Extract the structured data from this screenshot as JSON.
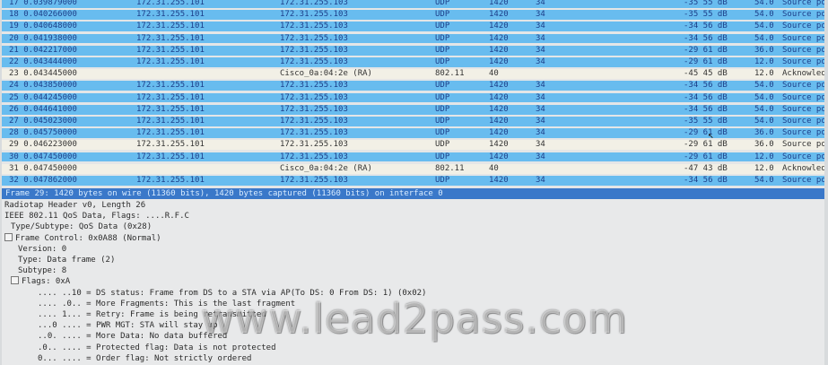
{
  "packets": [
    {
      "no_time": "17 0.039879000",
      "src": "172.31.255.101",
      "dst": "172.31.255.103",
      "proto": "UDP",
      "len": "1420",
      "info1": "34",
      "signal": "-35 55 dB",
      "rate": "54.0",
      "info": "Source port:"
    },
    {
      "no_time": "18 0.040266000",
      "src": "172.31.255.101",
      "dst": "172.31.255.103",
      "proto": "UDP",
      "len": "1420",
      "info1": "34",
      "signal": "-35 55 dB",
      "rate": "54.0",
      "info": "Source port:"
    },
    {
      "no_time": "19 0.040648000",
      "src": "172.31.255.101",
      "dst": "172.31.255.103",
      "proto": "UDP",
      "len": "1420",
      "info1": "34",
      "signal": "-34 56 dB",
      "rate": "54.0",
      "info": "Source port:"
    },
    {
      "no_time": "20 0.041938000",
      "src": "172.31.255.101",
      "dst": "172.31.255.103",
      "proto": "UDP",
      "len": "1420",
      "info1": "34",
      "signal": "-34 56 dB",
      "rate": "54.0",
      "info": "Source port:"
    },
    {
      "no_time": "21 0.042217000",
      "src": "172.31.255.101",
      "dst": "172.31.255.103",
      "proto": "UDP",
      "len": "1420",
      "info1": "34",
      "signal": "-29 61 dB",
      "rate": "36.0",
      "info": "Source port:"
    },
    {
      "no_time": "22 0.043444000",
      "src": "172.31.255.101",
      "dst": "172.31.255.103",
      "proto": "UDP",
      "len": "1420",
      "info1": "34",
      "signal": "-29 61 dB",
      "rate": "12.0",
      "info": "Source port:"
    },
    {
      "no_time": "23 0.043445000",
      "src": "",
      "dst": "Cisco_0a:04:2e (RA)",
      "proto": "802.11",
      "len": "40",
      "info1": "",
      "signal": "-45 45 dB",
      "rate": "12.0",
      "info": "Acknowledgeme"
    },
    {
      "no_time": "24 0.043850000",
      "src": "172.31.255.101",
      "dst": "172.31.255.103",
      "proto": "UDP",
      "len": "1420",
      "info1": "34",
      "signal": "-34 56 dB",
      "rate": "54.0",
      "info": "Source port:"
    },
    {
      "no_time": "25 0.044245000",
      "src": "172.31.255.101",
      "dst": "172.31.255.103",
      "proto": "UDP",
      "len": "1420",
      "info1": "34",
      "signal": "-34 56 dB",
      "rate": "54.0",
      "info": "Source port:"
    },
    {
      "no_time": "26 0.044641000",
      "src": "172.31.255.101",
      "dst": "172.31.255.103",
      "proto": "UDP",
      "len": "1420",
      "info1": "34",
      "signal": "-34 56 dB",
      "rate": "54.0",
      "info": "Source port:"
    },
    {
      "no_time": "27 0.045023000",
      "src": "172.31.255.101",
      "dst": "172.31.255.103",
      "proto": "UDP",
      "len": "1420",
      "info1": "34",
      "signal": "-35 55 dB",
      "rate": "54.0",
      "info": "Source port:"
    },
    {
      "no_time": "28 0.045750000",
      "src": "172.31.255.101",
      "dst": "172.31.255.103",
      "proto": "UDP",
      "len": "1420",
      "info1": "34",
      "signal": "-29 61 dB",
      "rate": "36.0",
      "info": "Source port:"
    },
    {
      "no_time": "29 0.046223000",
      "src": "172.31.255.101",
      "dst": "172.31.255.103",
      "proto": "UDP",
      "len": "1420",
      "info1": "34",
      "signal": "-29 61 dB",
      "rate": "36.0",
      "info": "Source port:"
    },
    {
      "no_time": "30 0.047450000",
      "src": "172.31.255.101",
      "dst": "172.31.255.103",
      "proto": "UDP",
      "len": "1420",
      "info1": "34",
      "signal": "-29 61 dB",
      "rate": "12.0",
      "info": "Source port:"
    },
    {
      "no_time": "31 0.047450000",
      "src": "",
      "dst": "Cisco_0a:04:2e (RA)",
      "proto": "802.11",
      "len": "40",
      "info1": "",
      "signal": "-47 43 dB",
      "rate": "12.0",
      "info": "Acknowledgeme"
    },
    {
      "no_time": "32 0.047862000",
      "src": "172.31.255.101",
      "dst": "172.31.255.103",
      "proto": "UDP",
      "len": "1420",
      "info1": "34",
      "signal": "-34 56 dB",
      "rate": "54.0",
      "info": "Source port:"
    }
  ],
  "row_styles": [
    "cyan",
    "cyan",
    "cyan",
    "cyan",
    "cyan",
    "cyan",
    "beige",
    "cyan",
    "cyan",
    "cyan",
    "cyan",
    "cyan",
    "beige",
    "cyan",
    "beige",
    "cyan"
  ],
  "details": {
    "frame_summary": "Frame 29: 1420 bytes on wire (11360 bits), 1420 bytes captured (11360 bits) on interface 0",
    "lines": [
      {
        "text": "Radiotap Header v0, Length 26",
        "indent": 0,
        "toggle": false
      },
      {
        "text": "IEEE 802.11 QoS Data, Flags: ....R.F.C",
        "indent": 0,
        "toggle": false
      },
      {
        "text": "Type/Subtype: QoS Data (0x28)",
        "indent": 1,
        "toggle": false
      },
      {
        "text": "Frame Control: 0x0A88 (Normal)",
        "indent": 0,
        "toggle": true
      },
      {
        "text": "Version: 0",
        "indent": 2,
        "toggle": false
      },
      {
        "text": "Type: Data frame (2)",
        "indent": 2,
        "toggle": false
      },
      {
        "text": "Subtype: 8",
        "indent": 2,
        "toggle": false
      },
      {
        "text": "Flags: 0xA",
        "indent": 1,
        "toggle": true
      },
      {
        "text": ".... ..10 = DS status: Frame from DS to a STA via AP(To DS: 0 From DS: 1) (0x02)",
        "indent": 3,
        "toggle": false
      },
      {
        "text": ".... .0.. = More Fragments: This is the last fragment",
        "indent": 3,
        "toggle": false
      },
      {
        "text": ".... 1... = Retry: Frame is being retransmitted",
        "indent": 3,
        "toggle": false
      },
      {
        "text": "...0 .... = PWR MGT: STA will stay up",
        "indent": 3,
        "toggle": false
      },
      {
        "text": "..0. .... = More Data: No data buffered",
        "indent": 3,
        "toggle": false
      },
      {
        "text": ".0.. .... = Protected flag: Data is not protected",
        "indent": 3,
        "toggle": false
      },
      {
        "text": "0... .... = Order flag: Not strictly ordered",
        "indent": 3,
        "toggle": false
      }
    ]
  },
  "watermark": "www.lead2pass.com",
  "colors": {
    "selected_row": "#68bcef",
    "ack_row": "#f2f0e6",
    "frame_bar": "#3a78c9"
  }
}
